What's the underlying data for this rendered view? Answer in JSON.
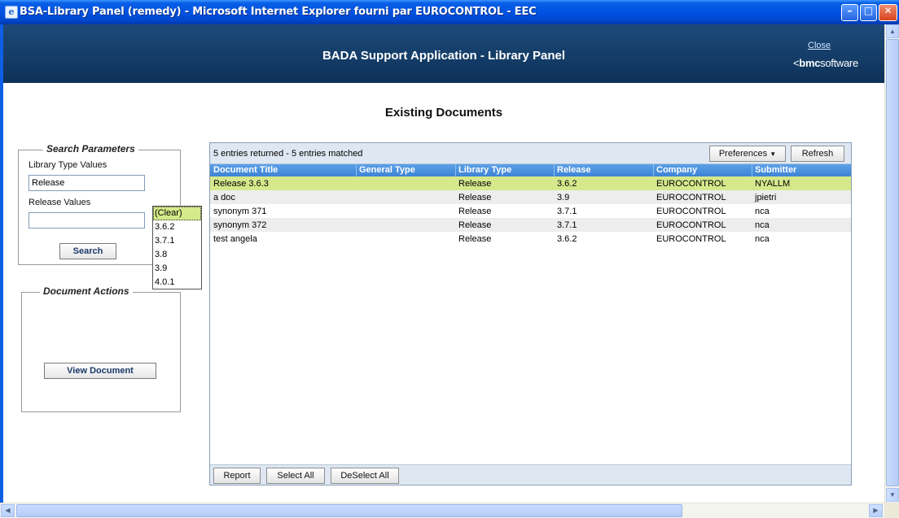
{
  "window": {
    "title": "BSA-Library Panel (remedy) - Microsoft Internet Explorer fourni par EUROCONTROL - EEC",
    "minimize_glyph": "–",
    "maximize_glyph": "□",
    "close_glyph": "✕"
  },
  "header": {
    "app_title": "BADA Support Application - Library Panel",
    "close_link": "Close",
    "brand_prefix": "<",
    "brand_bold": "bmc",
    "brand_rest": "software"
  },
  "page": {
    "section_title": "Existing Documents"
  },
  "search_params": {
    "legend": "Search Parameters",
    "library_type_label": "Library Type Values",
    "library_type_value": "Release",
    "release_label": "Release Values",
    "release_value": "",
    "search_button": "Search",
    "dropdown_icon": "caret-down-icon",
    "dropdown_options": [
      "(Clear)",
      "3.6.2",
      "3.7.1",
      "3.8",
      "3.9",
      "4.0.1"
    ],
    "dropdown_highlighted": "(Clear)"
  },
  "document_actions": {
    "legend": "Document Actions",
    "view_button": "View Document"
  },
  "table": {
    "status": "5 entries returned - 5 entries matched",
    "preferences_button": "Preferences",
    "preferences_icon": "caret-down-icon",
    "refresh_button": "Refresh",
    "columns": [
      "Document Title",
      "General Type",
      "Library Type",
      "Release",
      "Company",
      "Submitter"
    ],
    "rows": [
      [
        "Release 3.6.3",
        "",
        "Release",
        "3.6.2",
        "EUROCONTROL",
        "NYALLM"
      ],
      [
        "a doc",
        "",
        "Release",
        "3.9",
        "EUROCONTROL",
        "jpietri"
      ],
      [
        "synonym 371",
        "",
        "Release",
        "3.7.1",
        "EUROCONTROL",
        "nca"
      ],
      [
        "synonym 372",
        "",
        "Release",
        "3.7.1",
        "EUROCONTROL",
        "nca"
      ],
      [
        "test angela",
        "",
        "Release",
        "3.6.2",
        "EUROCONTROL",
        "nca"
      ]
    ],
    "selected_row": 0,
    "footer_buttons": [
      "Report",
      "Select All",
      "DeSelect All"
    ]
  },
  "colors": {
    "header_bg": "#143d68",
    "table_header_bg": "#4a8fdc",
    "selected_row_bg": "#d6e88c",
    "alt_row_bg": "#ededed"
  }
}
